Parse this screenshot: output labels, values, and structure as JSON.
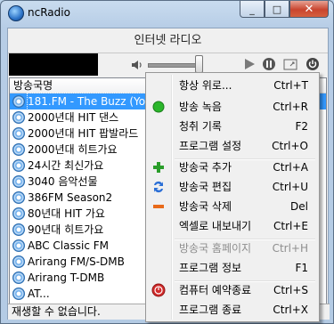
{
  "window": {
    "title": "ncRadio",
    "close_glyph": "✕",
    "minimize_glyph": "_",
    "maximize_glyph": "□"
  },
  "header": {
    "station_title": "인터넷 라디오"
  },
  "list": {
    "column_header": "방송국명",
    "items": [
      "181.FM - The Buzz (Your",
      "2000년대 HIT 댄스",
      "2000년대 HIT 팝발라드",
      "2000년대 히트가요",
      "24시간 최신가요",
      "3040 음악선물",
      "386FM Season2",
      "80년대 HIT 가요",
      "90년대 히트가요",
      "ABC Classic FM",
      "Arirang FM/S-DMB",
      "Arirang T-DMB",
      "AT..."
    ],
    "selected_index": 0
  },
  "status": {
    "text": "재생할 수 없습니다."
  },
  "menu": {
    "items": [
      {
        "label": "항상 위로...",
        "shortcut": "Ctrl+T",
        "icon": "",
        "disabled": false
      },
      {
        "label": "방송 녹음",
        "shortcut": "Ctrl+R",
        "icon": "record-green-dot-icon",
        "disabled": false
      },
      {
        "label": "청취 기록",
        "shortcut": "F2",
        "icon": "",
        "disabled": false
      },
      {
        "label": "프로그램 설정",
        "shortcut": "Ctrl+O",
        "icon": "",
        "disabled": false
      },
      {
        "label": "방송국 추가",
        "shortcut": "Ctrl+A",
        "icon": "plus-icon",
        "disabled": false
      },
      {
        "label": "방송국 편집",
        "shortcut": "Ctrl+U",
        "icon": "edit-arrows-icon",
        "disabled": false
      },
      {
        "label": "방송국 삭제",
        "shortcut": "Del",
        "icon": "minus-icon",
        "disabled": false
      },
      {
        "label": "엑셀로 내보내기",
        "shortcut": "Ctrl+E",
        "icon": "",
        "disabled": false
      },
      {
        "label": "방송국 홈페이지",
        "shortcut": "Ctrl+H",
        "icon": "",
        "disabled": true
      },
      {
        "label": "프로그램 정보",
        "shortcut": "F1",
        "icon": "",
        "disabled": false
      },
      {
        "label": "컴퓨터 예약종료",
        "shortcut": "Ctrl+S",
        "icon": "shutdown-timer-icon",
        "disabled": false
      },
      {
        "label": "프로그램 종료",
        "shortcut": "Ctrl+X",
        "icon": "",
        "disabled": false
      }
    ]
  },
  "colors": {
    "accent": "#3399ff",
    "record": "#2bb62b",
    "add": "#2a9d2a",
    "remove": "#e86a1a",
    "edit": "#2b6fd6",
    "shutdown": "#d22b2b"
  }
}
